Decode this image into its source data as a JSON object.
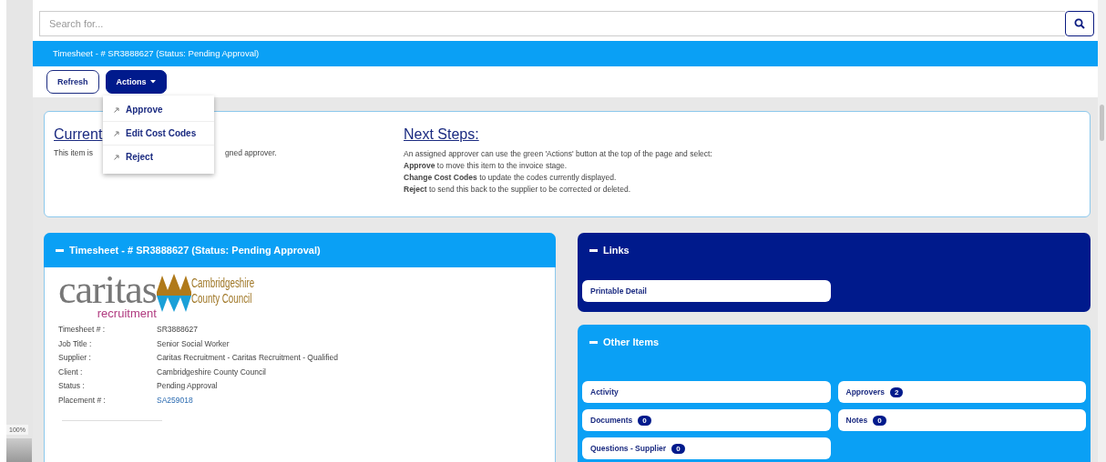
{
  "search": {
    "placeholder": "Search for..."
  },
  "title_bar": "Timesheet - # SR3888627 (Status: Pending Approval)",
  "toolbar": {
    "buttons": [
      {
        "label": "Refresh",
        "kind": "outline"
      },
      {
        "label": "Actions",
        "kind": "dropdown"
      }
    ]
  },
  "actions_menu": {
    "items": [
      "Approve",
      "Edit Cost Codes",
      "Reject"
    ]
  },
  "current": {
    "heading": "Current",
    "text_before": "This item is",
    "text_after": "gned approver."
  },
  "next_steps": {
    "heading": "Next Steps:",
    "lines": [
      "An assigned approver can use the green 'Actions' button at the top of the page and select:",
      "**Approve** to move this item to the invoice stage.",
      "**Change Cost Codes** to update the codes currently displayed.",
      "**Reject** to send this back to the supplier to be corrected or deleted."
    ]
  },
  "timesheet_panel": {
    "title": "Timesheet - # SR3888627 (Status: Pending Approval)",
    "logo": {
      "name": "caritas",
      "tagline": "recruitment",
      "council": [
        "Cambridgeshire",
        "County Council"
      ]
    },
    "fields": [
      {
        "label": "Timesheet # :",
        "value": "SR3888627",
        "kind": "text"
      },
      {
        "label": "Job Title :",
        "value": "Senior Social Worker",
        "kind": "text"
      },
      {
        "label": "Supplier :",
        "value": "Caritas Recruitment - Caritas Recruitment - Qualified",
        "kind": "text"
      },
      {
        "label": "Client :",
        "value": "Cambridgeshire County Council",
        "kind": "text"
      },
      {
        "label": "Status :",
        "value": "Pending Approval",
        "kind": "text"
      },
      {
        "label": "Placement # :",
        "value": "SA259018",
        "kind": "link"
      }
    ]
  },
  "links_panel": {
    "title": "Links",
    "items": [
      "Printable Detail"
    ]
  },
  "other_items": {
    "title": "Other Items",
    "items": [
      {
        "label": "Activity"
      },
      {
        "label": "Approvers",
        "count": "2"
      },
      {
        "label": "Documents",
        "count": "0"
      },
      {
        "label": "Notes",
        "count": "0"
      },
      {
        "label": "Questions - Supplier",
        "count": "0"
      }
    ]
  },
  "zoom_level": "100%"
}
